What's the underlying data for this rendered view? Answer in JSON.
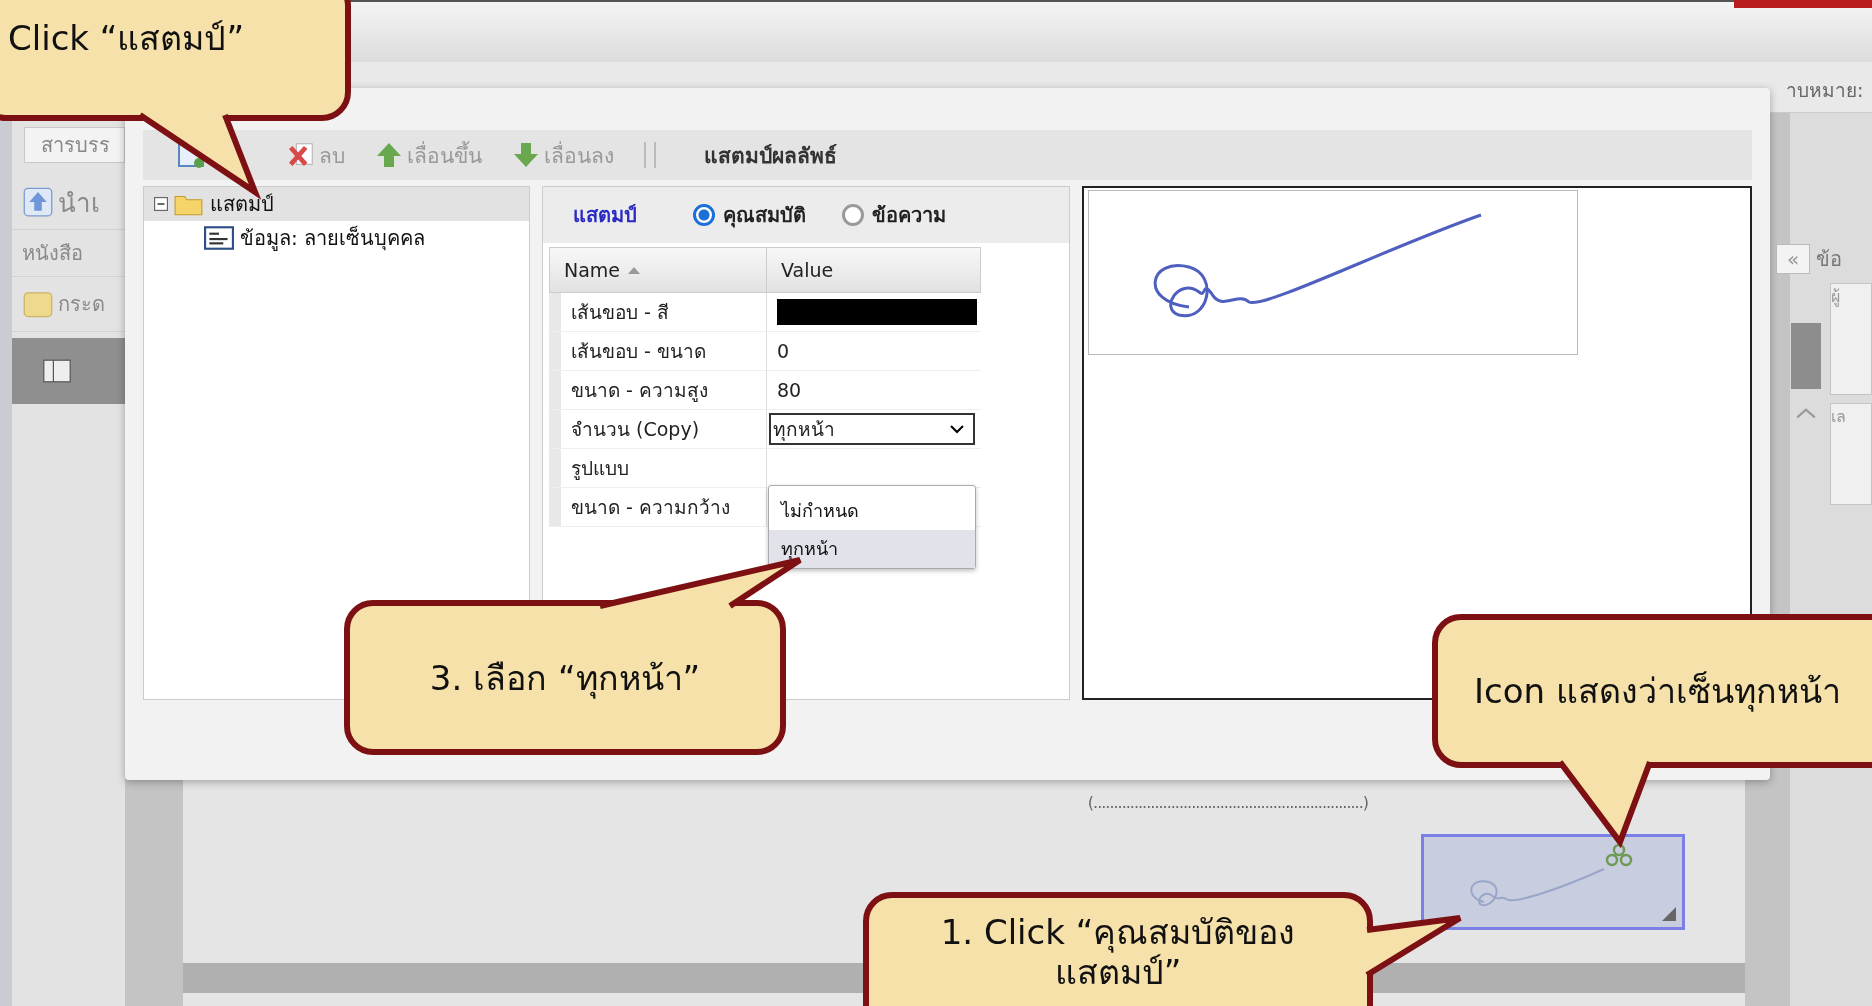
{
  "app": {
    "sidebar": [
      {
        "label": "สารบรร",
        "kind": "button"
      },
      {
        "label": "นำเ",
        "kind": "upload"
      },
      {
        "label": "หนังสือ",
        "kind": "heading"
      },
      {
        "label": "กระด",
        "kind": "folder"
      }
    ],
    "right_panel": {
      "label": "าบหมาย:",
      "collapse": "«",
      "texts": [
        "ข้อ",
        "ผู้",
        "เล"
      ]
    },
    "signature_line": "(..................................................................)"
  },
  "dialog": {
    "toolbar": [
      {
        "label": "ลบ",
        "kind": "delete"
      },
      {
        "label": "เลื่อนขึ้น",
        "kind": "up"
      },
      {
        "label": "เลื่อนลง",
        "kind": "down"
      }
    ],
    "title": "แสตมป์ผลลัพธ์",
    "tree": {
      "label": "แสตมป์",
      "expanded": true,
      "selected": true,
      "children": [
        {
          "label": "ข้อมูล: ลายเซ็นบุคคล",
          "selected": false
        }
      ]
    },
    "properties": {
      "link": "แสตมป์",
      "modes": [
        {
          "label": "คุณสมบัติ",
          "selected": true
        },
        {
          "label": "ข้อความ",
          "selected": false
        }
      ],
      "columns": [
        "Name",
        "Value"
      ],
      "rows": [
        {
          "name": "เส้นขอบ - สี",
          "kind": "color",
          "color": "#000000"
        },
        {
          "name": "เส้นขอบ - ขนาด",
          "kind": "text",
          "value": "0"
        },
        {
          "name": "ขนาด - ความสูง",
          "kind": "text",
          "value": "80"
        },
        {
          "name": "จำนวน (Copy)",
          "kind": "select",
          "value": "ทุกหน้า"
        },
        {
          "name": "รูปแบบ",
          "kind": "text"
        },
        {
          "name": "ขนาด - ความกว้าง",
          "kind": "text"
        }
      ],
      "dropdown": [
        {
          "label": "ไม่กำหนด",
          "selected": false
        },
        {
          "label": "ทุกหน้า",
          "selected": true
        }
      ]
    }
  },
  "callouts": [
    {
      "text": "Click “แสตมป์”"
    },
    {
      "text": "3. เลือก “ทุกหน้า”"
    },
    {
      "text": "Icon แสดงว่าเซ็นทุกหน้า"
    },
    {
      "text": "1. Click “คุณสมบัติของ แสตมป์”"
    }
  ]
}
